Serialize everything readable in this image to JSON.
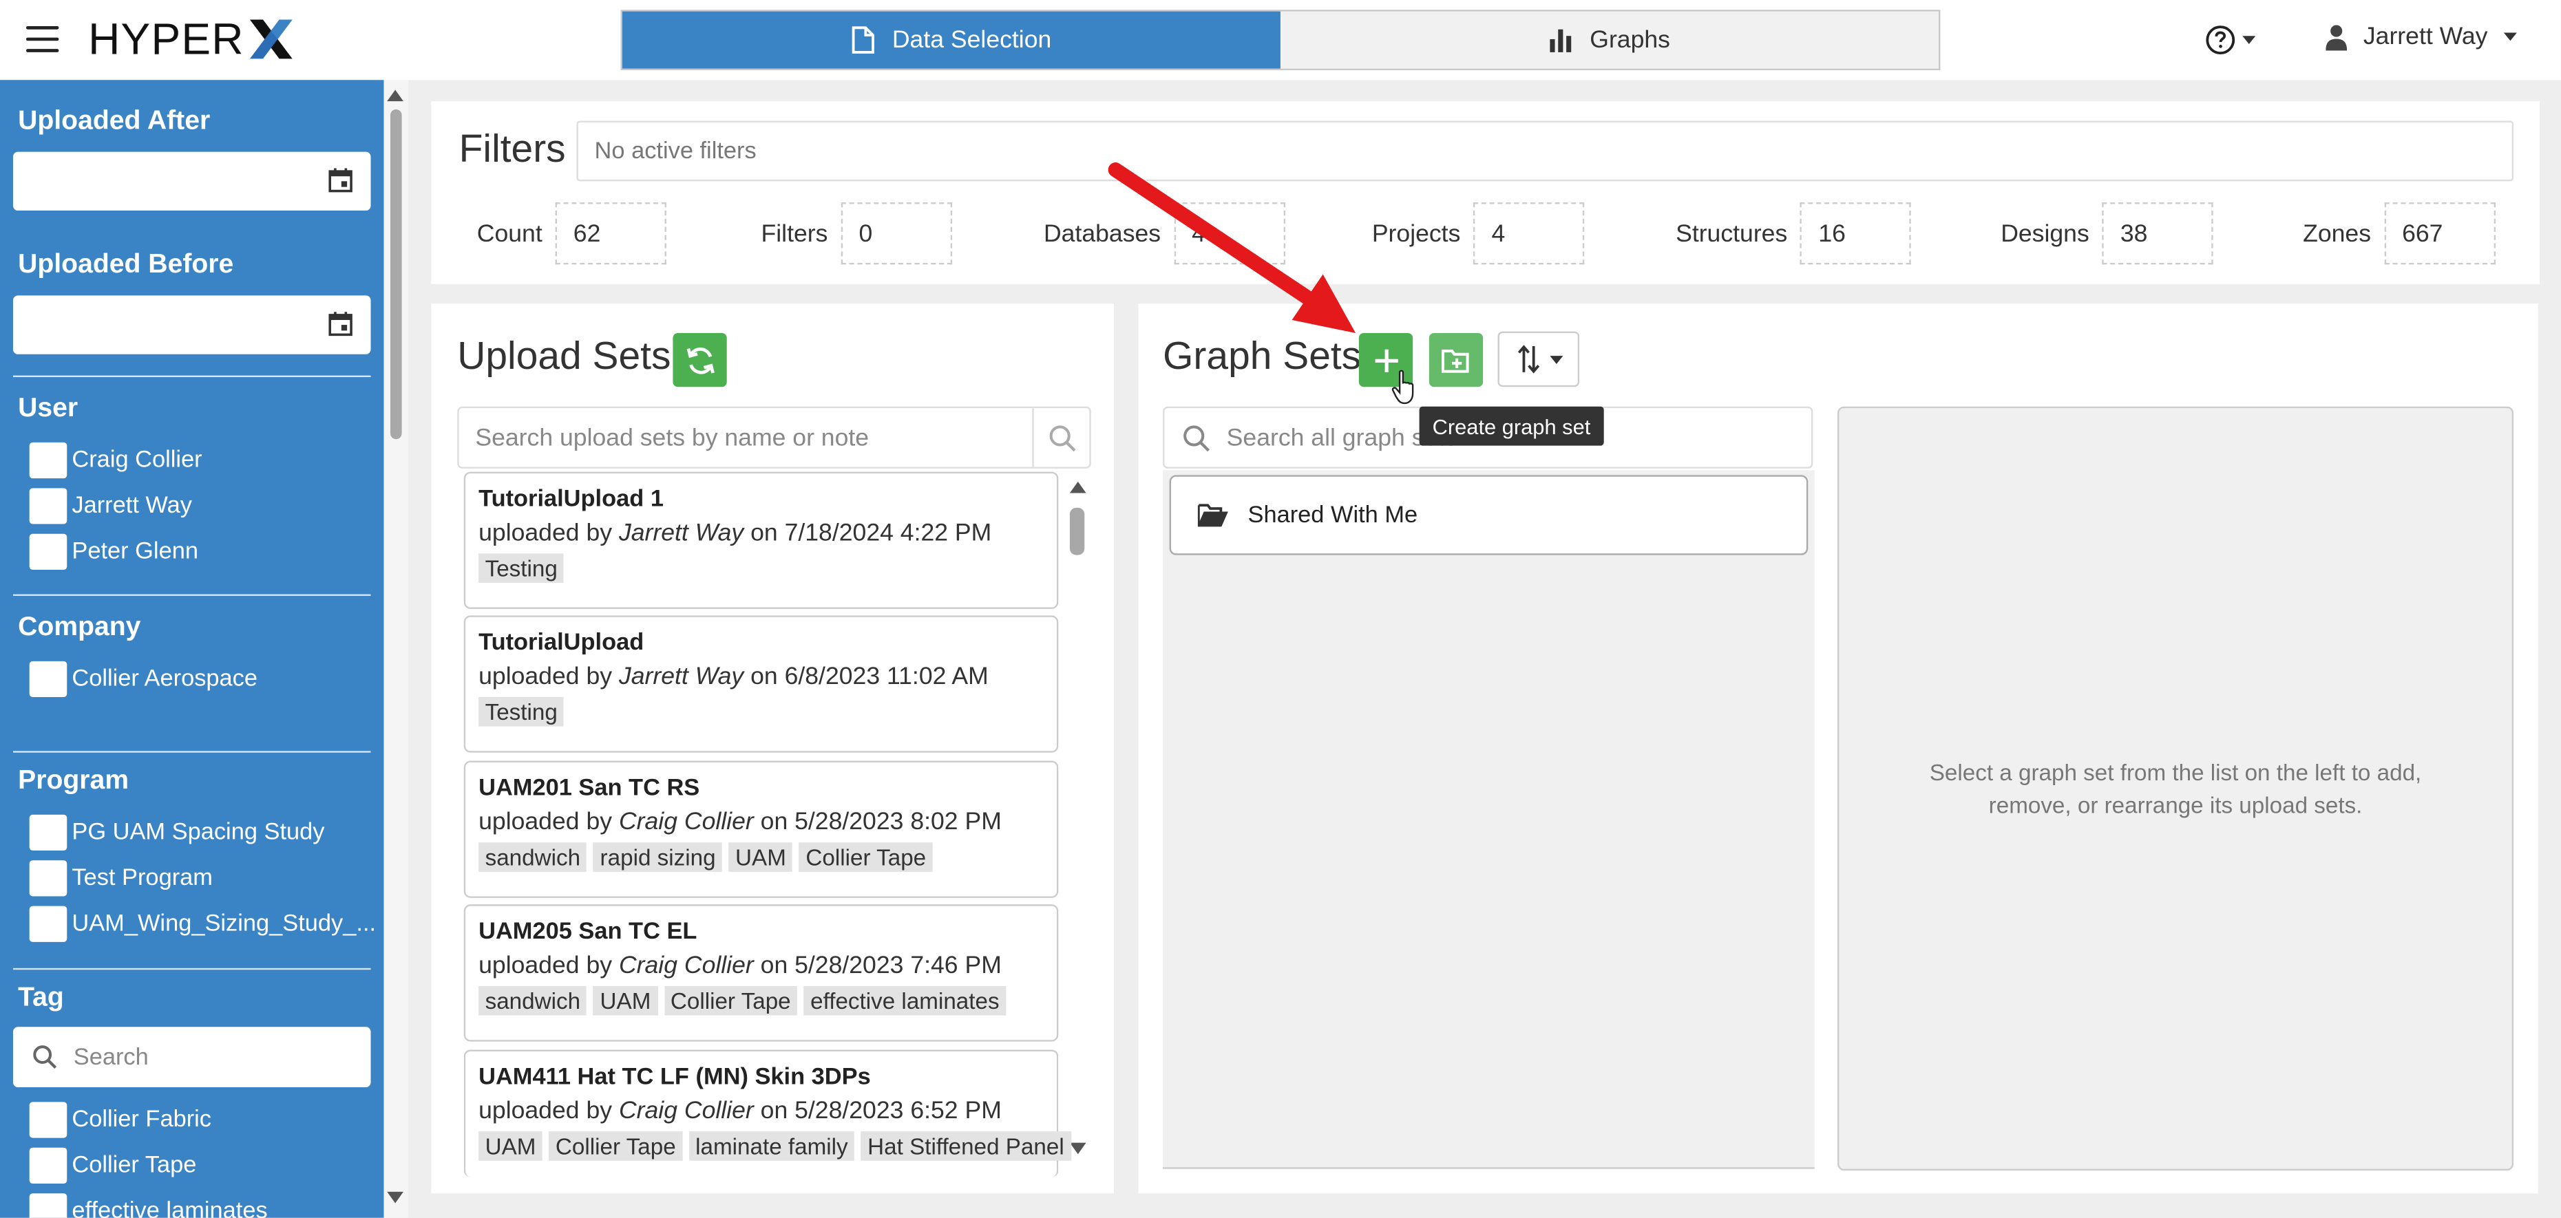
{
  "app": {
    "logo_text": "HYPER"
  },
  "nav": {
    "tabs": [
      {
        "label": "Data Selection",
        "icon": "document-icon",
        "active": true
      },
      {
        "label": "Graphs",
        "icon": "bar-chart-icon",
        "active": false
      }
    ]
  },
  "user": {
    "name": "Jarrett Way"
  },
  "sidebar": {
    "uploaded_after": "Uploaded After",
    "uploaded_before": "Uploaded Before",
    "user_heading": "User",
    "users": [
      "Craig Collier",
      "Jarrett Way",
      "Peter Glenn"
    ],
    "company_heading": "Company",
    "companies": [
      "Collier Aerospace"
    ],
    "program_heading": "Program",
    "programs": [
      "PG UAM Spacing Study",
      "Test Program",
      "UAM_Wing_Sizing_Study_..."
    ],
    "tag_heading": "Tag",
    "tag_search_placeholder": "Search",
    "tags": [
      "Collier Fabric",
      "Collier Tape",
      "effective laminates"
    ]
  },
  "filters": {
    "title": "Filters",
    "active_filters": "No active filters",
    "stats": [
      {
        "label": "Count",
        "value": "62"
      },
      {
        "label": "Filters",
        "value": "0"
      },
      {
        "label": "Databases",
        "value": "4"
      },
      {
        "label": "Projects",
        "value": "4"
      },
      {
        "label": "Structures",
        "value": "16"
      },
      {
        "label": "Designs",
        "value": "38"
      },
      {
        "label": "Zones",
        "value": "667"
      }
    ]
  },
  "upload_sets": {
    "title": "Upload Sets",
    "search_placeholder": "Search upload sets by name or note",
    "items": [
      {
        "name": "TutorialUpload 1",
        "prefix": "uploaded by",
        "user": "Jarrett Way",
        "date": "on 7/18/2024 4:22 PM",
        "tags": [
          "Testing"
        ]
      },
      {
        "name": "TutorialUpload",
        "prefix": "uploaded by",
        "user": "Jarrett Way",
        "date": "on 6/8/2023 11:02 AM",
        "tags": [
          "Testing"
        ]
      },
      {
        "name": "UAM201 San TC RS",
        "prefix": "uploaded by",
        "user": "Craig Collier",
        "date": "on 5/28/2023 8:02 PM",
        "tags": [
          "sandwich",
          "rapid sizing",
          "UAM",
          "Collier Tape"
        ]
      },
      {
        "name": "UAM205 San TC EL",
        "prefix": "uploaded by",
        "user": "Craig Collier",
        "date": "on 5/28/2023 7:46 PM",
        "tags": [
          "sandwich",
          "UAM",
          "Collier Tape",
          "effective laminates"
        ]
      },
      {
        "name": "UAM411 Hat TC LF (MN) Skin 3DPs",
        "prefix": "uploaded by",
        "user": "Craig Collier",
        "date": "on 5/28/2023 6:52 PM",
        "tags": [
          "UAM",
          "Collier Tape",
          "laminate family",
          "Hat Stiffened Panel"
        ]
      }
    ]
  },
  "graph_sets": {
    "title": "Graph Sets",
    "search_placeholder": "Search all graph sets",
    "tooltip": "Create graph set",
    "folders": [
      "Shared With Me"
    ],
    "empty_message": "Select a graph set from the list on the left to add, remove, or rearrange its upload sets."
  },
  "colors": {
    "accent": "#3a84c6",
    "green": "#4caf50",
    "annotation_arrow": "#e3191c"
  }
}
